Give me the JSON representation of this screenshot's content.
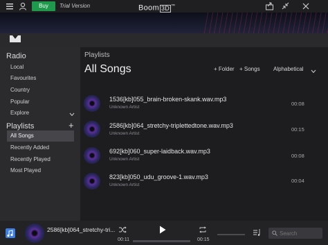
{
  "titlebar": {
    "buy_label": "Buy",
    "trial_label": "Trial Version",
    "app_title": "Boom",
    "app_title_box": "3D",
    "app_title_tm": "™"
  },
  "sidebar": {
    "radio_title": "Radio",
    "radio_items": [
      "Local",
      "Favourites",
      "Country",
      "Popular",
      "Explore"
    ],
    "playlists_title": "Playlists",
    "add_symbol": "+",
    "playlist_items": [
      "All Songs",
      "Recently Added",
      "Recently Played",
      "Most Played"
    ]
  },
  "main": {
    "breadcrumb": "Playlists",
    "title": "All Songs",
    "add_folder_label": "+ Folder",
    "add_songs_label": "+ Songs",
    "sort_label": "Alphabetical",
    "songs": [
      {
        "title": "1536[kb]055_brain-broken-skank.wav.mp3",
        "artist": "Unknown Artist",
        "duration": "00:08"
      },
      {
        "title": "2586[kb]064_stretchy-triplettedtone.wav.mp3",
        "artist": "Unknown Artist",
        "duration": "00:15"
      },
      {
        "title": "692[kb]060_super-laidback.wav.mp3",
        "artist": "Unknown Artist",
        "duration": "00:08"
      },
      {
        "title": "823[kb]050_udu_groove-1.wav.mp3",
        "artist": "Unknown Artist",
        "duration": "00:04"
      }
    ]
  },
  "player": {
    "now_playing": "2586[kb]064_stretchy-tri...",
    "elapsed": "00:11",
    "total": "00:15",
    "progress_fraction": 0.0,
    "search_placeholder": "Search"
  },
  "colors": {
    "buy_green": "#1f9a4d",
    "sidebar_bg": "#2b2b2e",
    "main_bg": "#1d1d20",
    "selected_bg": "#46464a"
  },
  "icons": [
    "menu-icon",
    "user-icon",
    "share-icon",
    "shrink-icon",
    "close-icon",
    "chevron-down-icon",
    "shuffle-icon",
    "play-icon",
    "repeat-icon",
    "queue-icon",
    "search-icon",
    "music-note-icon"
  ]
}
